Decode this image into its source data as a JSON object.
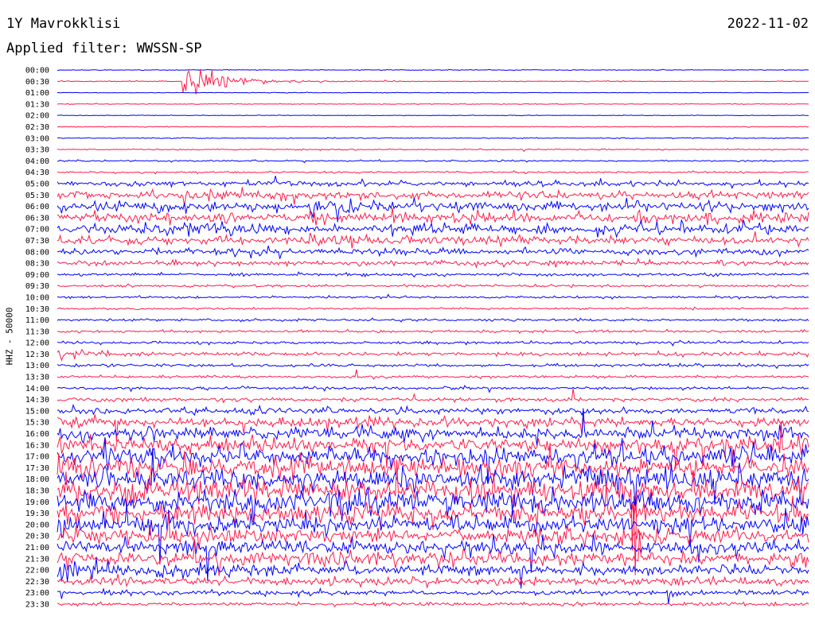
{
  "header": {
    "station": "1Y Mavrokklisi",
    "date": "2022-11-02",
    "filter_text": "Applied filter: WWSSN-SP"
  },
  "chart_data": {
    "type": "helicorder",
    "ylabel": "HHZ - 50000",
    "row_labels": [
      "00:00",
      "00:30",
      "01:00",
      "01:30",
      "02:00",
      "02:30",
      "03:00",
      "03:30",
      "04:00",
      "04:30",
      "05:00",
      "05:30",
      "06:00",
      "06:30",
      "07:00",
      "07:30",
      "08:00",
      "08:30",
      "09:00",
      "09:30",
      "10:00",
      "10:30",
      "11:00",
      "11:30",
      "12:00",
      "12:30",
      "13:00",
      "13:30",
      "14:00",
      "14:30",
      "15:00",
      "15:30",
      "16:00",
      "16:30",
      "17:00",
      "17:30",
      "18:00",
      "18:30",
      "19:00",
      "19:30",
      "20:00",
      "20:30",
      "21:00",
      "21:30",
      "22:00",
      "22:30",
      "23:00",
      "23:30"
    ],
    "colors": [
      "#0000ff",
      "#ff1a4a"
    ],
    "events": [
      {
        "time": "00:35",
        "peak": 4.0,
        "duration_min": 1.6
      },
      {
        "time": "05:35",
        "peak": 1.8,
        "duration_min": 3.0
      },
      {
        "time": "06:10",
        "peak": 2.2,
        "duration_min": 3.0
      },
      {
        "time": "07:05",
        "peak": 2.5,
        "duration_min": 2.0
      },
      {
        "time": "07:40",
        "peak": 1.6,
        "duration_min": 4.0
      },
      {
        "time": "12:30",
        "peak": 1.2,
        "duration_min": 2.0
      },
      {
        "time": "15:30",
        "peak": 1.4,
        "duration_min": 4.0
      },
      {
        "time": "17:30",
        "peak": 1.8,
        "duration_min": 4.0
      },
      {
        "time": "18:20",
        "peak": 2.2,
        "duration_min": 5.0
      },
      {
        "time": "19:10",
        "peak": 2.0,
        "duration_min": 5.0
      },
      {
        "time": "21:05",
        "peak": 1.6,
        "duration_min": 3.0
      },
      {
        "time": "21:40",
        "peak": 2.5,
        "duration_min": 3.0
      },
      {
        "time": "22:00",
        "peak": 2.0,
        "duration_min": 4.0
      }
    ],
    "noise_level_per_row": [
      0.12,
      0.15,
      0.1,
      0.12,
      0.1,
      0.12,
      0.15,
      0.2,
      0.25,
      0.3,
      0.8,
      1.2,
      1.5,
      1.6,
      1.5,
      1.2,
      1.0,
      0.8,
      0.5,
      0.4,
      0.35,
      0.3,
      0.4,
      0.4,
      0.45,
      0.6,
      0.5,
      0.4,
      0.45,
      0.6,
      1.0,
      1.5,
      2.0,
      2.5,
      3.0,
      3.2,
      3.5,
      3.5,
      3.3,
      3.0,
      2.8,
      2.5,
      2.3,
      2.0,
      1.8,
      1.2,
      0.8,
      0.6
    ]
  }
}
